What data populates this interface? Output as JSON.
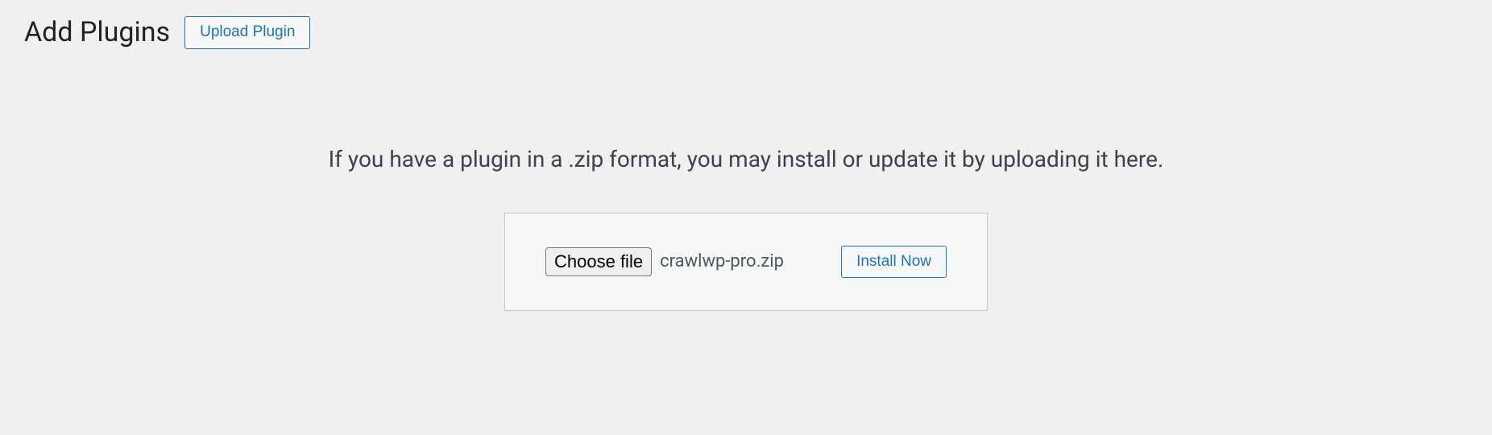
{
  "header": {
    "title": "Add Plugins",
    "upload_button_label": "Upload Plugin"
  },
  "upload_section": {
    "description": "If you have a plugin in a .zip format, you may install or update it by uploading it here.",
    "choose_file_label": "Choose file",
    "selected_file": "crawlwp-pro.zip",
    "install_button_label": "Install Now"
  }
}
